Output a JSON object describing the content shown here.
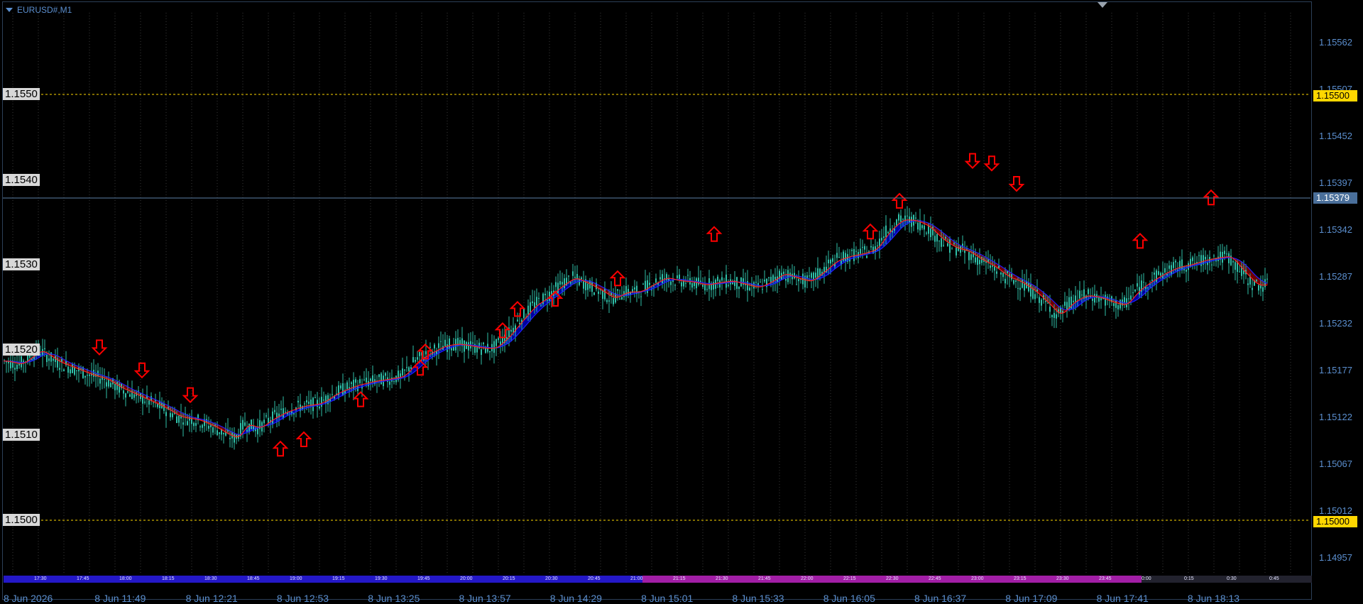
{
  "window": {
    "title": "EURUSD#,M1",
    "icons": [
      "collapse-triangle-icon",
      "chart-shift-icon"
    ]
  },
  "price_axis": {
    "ticks": [
      "1.15562",
      "1.15507",
      "1.15452",
      "1.15397",
      "1.15342",
      "1.15287",
      "1.15232",
      "1.15177",
      "1.15122",
      "1.15067",
      "1.15012",
      "1.14957"
    ],
    "current_price": "1.15379",
    "current_price_color": "#4a6f9a"
  },
  "levels": [
    {
      "label": "1.1550",
      "badge": "1.15500",
      "kind": "horizontal-line",
      "color": "#ffd700"
    },
    {
      "label": "1.1540",
      "badge": "",
      "kind": "text-only"
    },
    {
      "label": "1.1530",
      "badge": "",
      "kind": "text-only"
    },
    {
      "label": "1.1520",
      "badge": "",
      "kind": "text-only"
    },
    {
      "label": "1.1510",
      "badge": "",
      "kind": "text-only"
    },
    {
      "label": "1.1500",
      "badge": "1.15000",
      "kind": "horizontal-line",
      "color": "#ffd700"
    }
  ],
  "period_strip": {
    "ticks": [
      "17:30",
      "17:45",
      "18:00",
      "18:15",
      "18:30",
      "18:45",
      "19:00",
      "19:15",
      "19:30",
      "19:45",
      "20:00",
      "20:15",
      "20:30",
      "20:45",
      "21:00",
      "21:15",
      "21:30",
      "21:45",
      "22:00",
      "22:15",
      "22:30",
      "22:45",
      "23:00",
      "23:15",
      "23:30",
      "23:45",
      "0:00",
      "0:15",
      "0:30",
      "0:45"
    ],
    "colors": {
      "first": "#2418c8",
      "second": "#a21ea6"
    }
  },
  "time_axis": {
    "ticks": [
      "8 Jun 2026",
      "8 Jun 11:49",
      "8 Jun 12:21",
      "8 Jun 12:53",
      "8 Jun 13:25",
      "8 Jun 13:57",
      "8 Jun 14:29",
      "8 Jun 15:01",
      "8 Jun 15:33",
      "8 Jun 16:05",
      "8 Jun 16:37",
      "8 Jun 17:09",
      "8 Jun 17:41",
      "8 Jun 18:13"
    ]
  },
  "chart_data": {
    "type": "candlestick",
    "symbol": "EURUSD#",
    "timeframe": "M1",
    "price_range": [
      1.1494,
      1.1558
    ],
    "colors": {
      "candle": "#2fbfa8",
      "ma_bull": "#0000c8",
      "ma_bear": "#8a0000",
      "ma_fast": "#ff2020",
      "ma_slow": "#2020ff",
      "arrow": "#ff0000",
      "grid": "#3a3a3a",
      "current_line": "#5b7fa6"
    },
    "price_path": [
      [
        0,
        1.5187
      ],
      [
        18,
        1.5183
      ],
      [
        40,
        1.52
      ],
      [
        60,
        1.5186
      ],
      [
        80,
        1.5178
      ],
      [
        100,
        1.517
      ],
      [
        115,
        1.5166
      ],
      [
        130,
        1.5156
      ],
      [
        150,
        1.5147
      ],
      [
        165,
        1.514
      ],
      [
        180,
        1.5133
      ],
      [
        200,
        1.5121
      ],
      [
        220,
        1.5118
      ],
      [
        240,
        1.5109
      ],
      [
        255,
        1.51
      ],
      [
        265,
        1.5096
      ],
      [
        275,
        1.5113
      ],
      [
        290,
        1.5108
      ],
      [
        305,
        1.5119
      ],
      [
        320,
        1.5127
      ],
      [
        340,
        1.5134
      ],
      [
        360,
        1.5137
      ],
      [
        380,
        1.515
      ],
      [
        400,
        1.5158
      ],
      [
        420,
        1.5163
      ],
      [
        440,
        1.5166
      ],
      [
        455,
        1.5169
      ],
      [
        470,
        1.5187
      ],
      [
        485,
        1.5196
      ],
      [
        500,
        1.5204
      ],
      [
        515,
        1.5207
      ],
      [
        530,
        1.5205
      ],
      [
        545,
        1.5202
      ],
      [
        560,
        1.5202
      ],
      [
        575,
        1.5216
      ],
      [
        590,
        1.5235
      ],
      [
        605,
        1.5252
      ],
      [
        620,
        1.5262
      ],
      [
        635,
        1.5275
      ],
      [
        650,
        1.5285
      ],
      [
        665,
        1.5278
      ],
      [
        680,
        1.527
      ],
      [
        695,
        1.526
      ],
      [
        710,
        1.5268
      ],
      [
        725,
        1.5268
      ],
      [
        740,
        1.5277
      ],
      [
        755,
        1.5285
      ],
      [
        770,
        1.5281
      ],
      [
        785,
        1.528
      ],
      [
        800,
        1.5276
      ],
      [
        815,
        1.5279
      ],
      [
        830,
        1.5281
      ],
      [
        845,
        1.5277
      ],
      [
        860,
        1.5273
      ],
      [
        875,
        1.528
      ],
      [
        890,
        1.529
      ],
      [
        905,
        1.5284
      ],
      [
        920,
        1.528
      ],
      [
        935,
        1.5292
      ],
      [
        950,
        1.5305
      ],
      [
        965,
        1.531
      ],
      [
        980,
        1.5313
      ],
      [
        995,
        1.5318
      ],
      [
        1010,
        1.534
      ],
      [
        1025,
        1.5353
      ],
      [
        1040,
        1.5352
      ],
      [
        1055,
        1.5345
      ],
      [
        1070,
        1.533
      ],
      [
        1085,
        1.532
      ],
      [
        1100,
        1.5316
      ],
      [
        1115,
        1.5306
      ],
      [
        1130,
        1.5298
      ],
      [
        1145,
        1.5286
      ],
      [
        1160,
        1.528
      ],
      [
        1175,
        1.527
      ],
      [
        1190,
        1.5256
      ],
      [
        1205,
        1.524
      ],
      [
        1220,
        1.5256
      ],
      [
        1235,
        1.5264
      ],
      [
        1250,
        1.5262
      ],
      [
        1265,
        1.5256
      ],
      [
        1280,
        1.5252
      ],
      [
        1295,
        1.527
      ],
      [
        1310,
        1.5281
      ],
      [
        1325,
        1.529
      ],
      [
        1340,
        1.5297
      ],
      [
        1355,
        1.53
      ],
      [
        1370,
        1.5305
      ],
      [
        1385,
        1.5308
      ],
      [
        1400,
        1.531
      ],
      [
        1415,
        1.5292
      ],
      [
        1430,
        1.5276
      ],
      [
        1445,
        1.5276
      ]
    ],
    "arrows": [
      {
        "dir": "down",
        "price": 1.5203
      },
      {
        "dir": "down",
        "price": 1.5176
      },
      {
        "dir": "down",
        "price": 1.5147
      },
      {
        "dir": "up",
        "price": 1.5084
      },
      {
        "dir": "up",
        "price": 1.5095
      },
      {
        "dir": "up",
        "price": 1.5142
      },
      {
        "dir": "up",
        "price": 1.5179
      },
      {
        "dir": "up",
        "price": 1.5198
      },
      {
        "dir": "up",
        "price": 1.5223
      },
      {
        "dir": "up",
        "price": 1.5248
      },
      {
        "dir": "up",
        "price": 1.526
      },
      {
        "dir": "up",
        "price": 1.5284
      },
      {
        "dir": "up",
        "price": 1.5336
      },
      {
        "dir": "up",
        "price": 1.5339
      },
      {
        "dir": "up",
        "price": 1.5375
      },
      {
        "dir": "down",
        "price": 1.5422
      },
      {
        "dir": "down",
        "price": 1.5419
      },
      {
        "dir": "down",
        "price": 1.5395
      },
      {
        "dir": "up",
        "price": 1.5328
      },
      {
        "dir": "up",
        "price": 1.5379
      }
    ]
  }
}
